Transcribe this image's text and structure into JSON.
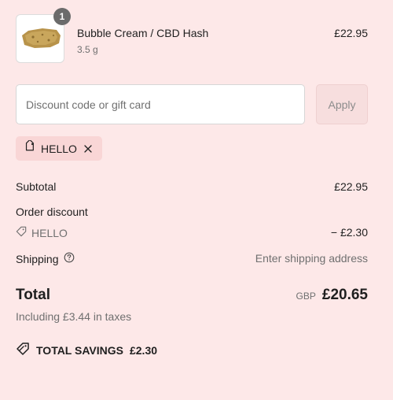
{
  "product": {
    "quantity": "1",
    "name": "Bubble Cream / CBD Hash",
    "variant": "3.5 g",
    "price": "£22.95"
  },
  "discount_form": {
    "placeholder": "Discount code or gift card",
    "value": "",
    "apply_label": "Apply"
  },
  "applied_code": {
    "label": "HELLO"
  },
  "summary": {
    "subtotal_label": "Subtotal",
    "subtotal_value": "£22.95",
    "order_discount_label": "Order discount",
    "discount_code": "HELLO",
    "discount_value": "− £2.30",
    "shipping_label": "Shipping",
    "shipping_value": "Enter shipping address",
    "total_label": "Total",
    "currency": "GBP",
    "total_value": "£20.65",
    "taxes_note": "Including £3.44 in taxes",
    "savings_label": "TOTAL SAVINGS",
    "savings_value": "£2.30"
  },
  "icons": {
    "tag": "tag-icon",
    "remove": "close-icon",
    "help": "question-circle-icon",
    "savings": "tag-double-icon"
  },
  "colors": {
    "background": "#fde8e8",
    "code_tag_bg": "#f9d6d6",
    "badge": "#6b6b6b",
    "muted_text": "#707070"
  }
}
